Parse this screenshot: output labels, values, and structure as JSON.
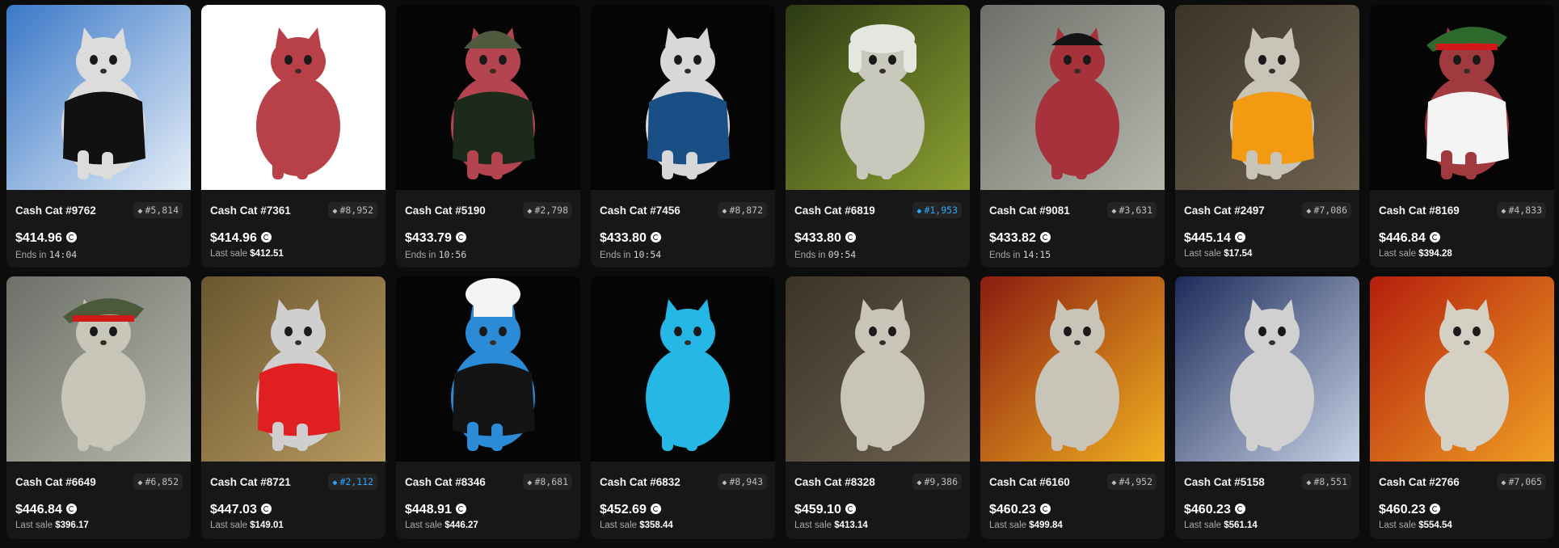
{
  "cards": [
    {
      "name": "Cash Cat #9762",
      "rank": "#5,814",
      "rank_top": false,
      "price": "$414.96",
      "sub_label": "Ends in",
      "sub_value": "14:04",
      "sub_kind": "timer",
      "bg": "#3a78c8",
      "bg2": "#e6eef7",
      "cat": "#dcdcdc",
      "shirt": "#111111",
      "hat": null,
      "hat_color": null
    },
    {
      "name": "Cash Cat #7361",
      "rank": "#8,952",
      "rank_top": false,
      "price": "$414.96",
      "sub_label": "Last sale",
      "sub_value": "$412.51",
      "sub_kind": "sale",
      "bg": "#ffffff",
      "bg2": "#ffffff",
      "cat": "#b84048",
      "shirt": null,
      "hat": null,
      "hat_color": null
    },
    {
      "name": "Cash Cat #5190",
      "rank": "#2,798",
      "rank_top": false,
      "price": "$433.79",
      "sub_label": "Ends in",
      "sub_value": "10:56",
      "sub_kind": "timer",
      "bg": "#050505",
      "bg2": "#050505",
      "cat": "#b44450",
      "shirt": "#1c2a1c",
      "hat": "helmet",
      "hat_color": "#4f5a3e"
    },
    {
      "name": "Cash Cat #7456",
      "rank": "#8,872",
      "rank_top": false,
      "price": "$433.80",
      "sub_label": "Ends in",
      "sub_value": "10:54",
      "sub_kind": "timer",
      "bg": "#050505",
      "bg2": "#050505",
      "cat": "#d8d8d8",
      "shirt": "#1a4f86",
      "hat": null,
      "hat_color": null
    },
    {
      "name": "Cash Cat #6819",
      "rank": "#1,953",
      "rank_top": true,
      "price": "$433.80",
      "sub_label": "Ends in",
      "sub_value": "09:54",
      "sub_kind": "timer",
      "bg": "#2c3a14",
      "bg2": "#8ca032",
      "cat": "#c8c8bc",
      "shirt": null,
      "hat": "ushanka",
      "hat_color": "#e6e6e0"
    },
    {
      "name": "Cash Cat #9081",
      "rank": "#3,631",
      "rank_top": false,
      "price": "$433.82",
      "sub_label": "Ends in",
      "sub_value": "14:15",
      "sub_kind": "timer",
      "bg": "#6d7068",
      "bg2": "#b5b8ad",
      "cat": "#a8323c",
      "shirt": null,
      "hat": "cap",
      "hat_color": "#141414"
    },
    {
      "name": "Cash Cat #2497",
      "rank": "#7,086",
      "rank_top": false,
      "price": "$445.14",
      "sub_label": "Last sale",
      "sub_value": "$17.54",
      "sub_kind": "sale",
      "bg": "#3c3428",
      "bg2": "#6e6250",
      "cat": "#c8c4b8",
      "shirt": "#f29a12",
      "hat": null,
      "hat_color": null
    },
    {
      "name": "Cash Cat #8169",
      "rank": "#4,833",
      "rank_top": false,
      "price": "$446.84",
      "sub_label": "Last sale",
      "sub_value": "$394.28",
      "sub_kind": "sale",
      "bg": "#050505",
      "bg2": "#050505",
      "cat": "#a03a3e",
      "shirt": "#f4f4f4",
      "hat": "feather",
      "hat_color": "#2e6a2e"
    },
    {
      "name": "Cash Cat #6649",
      "rank": "#6,852",
      "rank_top": false,
      "price": "$446.84",
      "sub_label": "Last sale",
      "sub_value": "$396.17",
      "sub_kind": "sale",
      "bg": "#6d7068",
      "bg2": "#b5b8ad",
      "cat": "#c8c6b8",
      "shirt": null,
      "hat": "feather",
      "hat_color": "#4a5a3a"
    },
    {
      "name": "Cash Cat #8721",
      "rank": "#2,112",
      "rank_top": true,
      "price": "$447.03",
      "sub_label": "Last sale",
      "sub_value": "$149.01",
      "sub_kind": "sale",
      "bg": "#6a5630",
      "bg2": "#b89a60",
      "cat": "#cfcfcf",
      "shirt": "#e02020",
      "hat": null,
      "hat_color": null
    },
    {
      "name": "Cash Cat #8346",
      "rank": "#8,681",
      "rank_top": false,
      "price": "$448.91",
      "sub_label": "Last sale",
      "sub_value": "$446.27",
      "sub_kind": "sale",
      "bg": "#050505",
      "bg2": "#050505",
      "cat": "#2c8bd6",
      "shirt": "#141414",
      "hat": "chef",
      "hat_color": "#f4f4f4"
    },
    {
      "name": "Cash Cat #6832",
      "rank": "#8,943",
      "rank_top": false,
      "price": "$452.69",
      "sub_label": "Last sale",
      "sub_value": "$358.44",
      "sub_kind": "sale",
      "bg": "#050505",
      "bg2": "#050505",
      "cat": "#25b8e6",
      "shirt": null,
      "hat": null,
      "hat_color": null
    },
    {
      "name": "Cash Cat #8328",
      "rank": "#9,386",
      "rank_top": false,
      "price": "$459.10",
      "sub_label": "Last sale",
      "sub_value": "$413.14",
      "sub_kind": "sale",
      "bg": "#3c3428",
      "bg2": "#6e6250",
      "cat": "#c8c4b8",
      "shirt": null,
      "hat": null,
      "hat_color": null
    },
    {
      "name": "Cash Cat #6160",
      "rank": "#4,952",
      "rank_top": false,
      "price": "$460.23",
      "sub_label": "Last sale",
      "sub_value": "$499.84",
      "sub_kind": "sale",
      "bg": "#8c1c10",
      "bg2": "#f0b020",
      "cat": "#c8c4b8",
      "shirt": null,
      "hat": null,
      "hat_color": null
    },
    {
      "name": "Cash Cat #5158",
      "rank": "#8,551",
      "rank_top": false,
      "price": "$460.23",
      "sub_label": "Last sale",
      "sub_value": "$561.14",
      "sub_kind": "sale",
      "bg": "#1c2c5a",
      "bg2": "#c8d2e6",
      "cat": "#d0d0d0",
      "shirt": null,
      "hat": null,
      "hat_color": null
    },
    {
      "name": "Cash Cat #2766",
      "rank": "#7,065",
      "rank_top": false,
      "price": "$460.23",
      "sub_label": "Last sale",
      "sub_value": "$554.54",
      "sub_kind": "sale",
      "bg": "#b41e0c",
      "bg2": "#f0a024",
      "cat": "#d4d0c4",
      "shirt": null,
      "hat": null,
      "hat_color": null
    }
  ]
}
